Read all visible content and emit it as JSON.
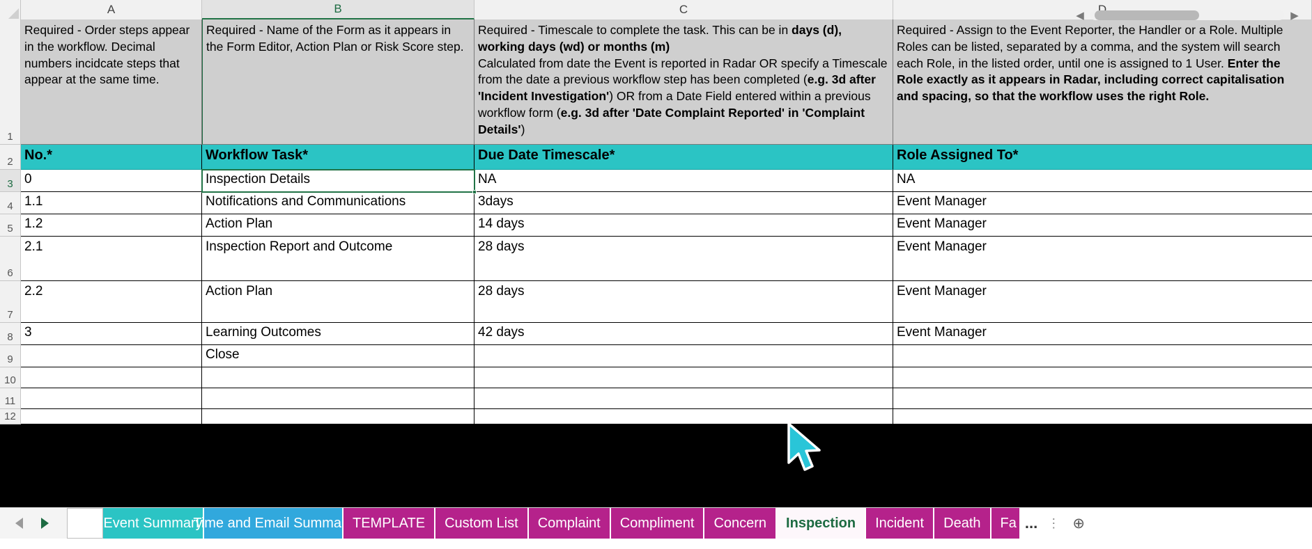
{
  "columns": [
    {
      "label": "A",
      "selected": false
    },
    {
      "label": "B",
      "selected": true
    },
    {
      "label": "C",
      "selected": false
    },
    {
      "label": "D",
      "selected": false
    }
  ],
  "row_numbers": [
    "1",
    "2",
    "3",
    "4",
    "5",
    "6",
    "7",
    "8",
    "9",
    "10",
    "11",
    "12"
  ],
  "info_row": {
    "a": "Required - Order steps appear in the workflow. Decimal numbers incidcate steps that appear at the same time.",
    "b": "Required - Name of the Form as it appears in the Form Editor, Action Plan or Risk Score step.",
    "c_part1": "Required - Timescale to complete the task. This can be in ",
    "c_bold1": "days (d), working days (wd) or months (m)",
    "c_part2": "Calculated from date the Event is reported in Radar OR specify a Timescale from the date a previous workflow step has been completed (",
    "c_bold2": "e.g. 3d after 'Incident Investigation'",
    "c_part3": ") OR from a Date Field entered within a previous workflow form (",
    "c_bold3": "e.g. 3d after 'Date Complaint Reported' in 'Complaint Details'",
    "c_part4": ")",
    "d_part1": "Required - Assign to the Event Reporter, the Handler or a Role. Multiple Roles can be listed, separated by a comma, and the system will search each Role, in the listed order, until one is assigned to 1 User. ",
    "d_bold1": "Enter the Role exactly as it appears in Radar, including correct capitalisation and spacing, so that the workflow uses the right Role."
  },
  "headers": {
    "a": "No.*",
    "b": "Workflow Task*",
    "c": "Due Date Timescale*",
    "d": "Role Assigned To*"
  },
  "rows": [
    {
      "row": "3",
      "no": "0",
      "task": "Inspection Details",
      "timescale": "NA",
      "role": "NA"
    },
    {
      "row": "4",
      "no": "1.1",
      "task": "Notifications and Communications",
      "timescale": "3days",
      "role": "Event Manager"
    },
    {
      "row": "5",
      "no": "1.2",
      "task": "Action Plan",
      "timescale": "14 days",
      "role": "Event Manager"
    },
    {
      "row": "6",
      "no": "2.1",
      "task": "Inspection Report and Outcome",
      "timescale": "28 days",
      "role": "Event Manager"
    },
    {
      "row": "7",
      "no": "2.2",
      "task": "Action Plan",
      "timescale": "28 days",
      "role": "Event Manager"
    },
    {
      "row": "8",
      "no": "3",
      "task": "Learning Outcomes",
      "timescale": "42 days",
      "role": "Event Manager"
    },
    {
      "row": "9",
      "no": "",
      "task": "Close",
      "timescale": "",
      "role": ""
    },
    {
      "row": "10",
      "no": "",
      "task": "",
      "timescale": "",
      "role": ""
    },
    {
      "row": "11",
      "no": "",
      "task": "",
      "timescale": "",
      "role": ""
    },
    {
      "row": "12",
      "no": "",
      "task": "",
      "timescale": "",
      "role": ""
    }
  ],
  "sheet_tabs": [
    {
      "label": "",
      "style": "blankwhite"
    },
    {
      "label": "Event Summary",
      "style": "teal"
    },
    {
      "label": "Time and Email Summary",
      "style": "blue"
    },
    {
      "label": "TEMPLATE",
      "style": "magenta"
    },
    {
      "label": "Custom List",
      "style": "magenta"
    },
    {
      "label": "Complaint",
      "style": "magenta"
    },
    {
      "label": "Compliment",
      "style": "magenta"
    },
    {
      "label": "Concern",
      "style": "magenta"
    },
    {
      "label": "Inspection",
      "style": "active"
    },
    {
      "label": "Incident",
      "style": "magenta"
    },
    {
      "label": "Death",
      "style": "magenta"
    },
    {
      "label": "Fa",
      "style": "magenta"
    }
  ],
  "tab_overflow": "...",
  "add_sheet_label": "+",
  "colors": {
    "header_teal": "#2bc4c4",
    "tab_magenta": "#b5228b",
    "selection_green": "#217346",
    "info_gray": "#cfcfcf",
    "cursor_cyan": "#29c5d8"
  }
}
